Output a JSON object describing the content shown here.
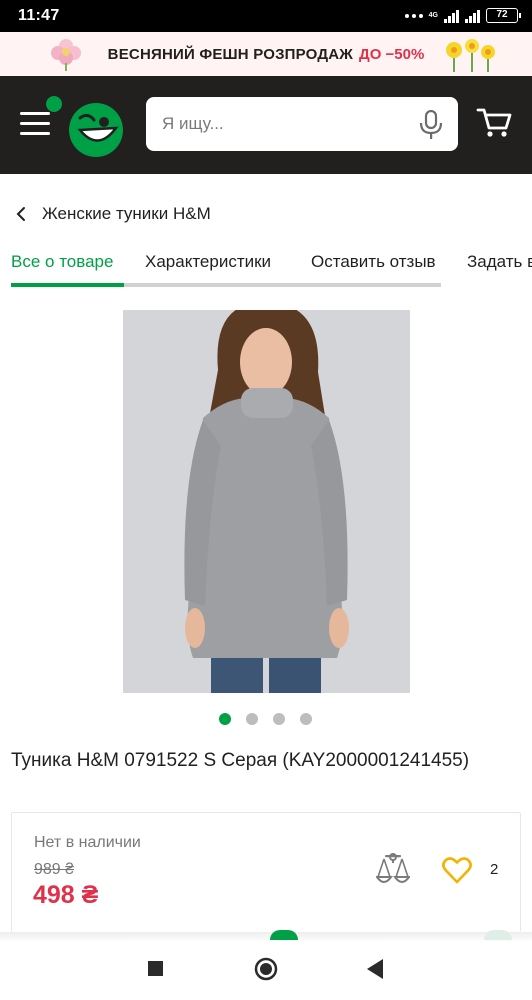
{
  "status_bar": {
    "time": "11:47",
    "network": "4G",
    "battery": "72"
  },
  "promo_banner": {
    "text": "ВЕСНЯНИЙ ФЕШН РОЗПРОДАЖ",
    "discount": "ДО −50%"
  },
  "header": {
    "search_placeholder": "Я ищу...",
    "icons": [
      "menu-icon",
      "logo",
      "mic-icon",
      "cart-icon"
    ]
  },
  "breadcrumb": {
    "label": "Женские туники H&M"
  },
  "tabs": [
    {
      "label": "Все о товаре",
      "active": true
    },
    {
      "label": "Характеристики",
      "active": false
    },
    {
      "label": "Оставить отзыв",
      "active": false
    },
    {
      "label": "Задать вопрос",
      "active": false
    }
  ],
  "gallery": {
    "slides_total": 4,
    "active_slide": 1
  },
  "product": {
    "title": "Туника H&M 0791522 S Серая (KAY2000001241455)",
    "availability": "Нет в наличии",
    "old_price": "989 ₴",
    "price": "498 ₴",
    "wishlist_count": "2"
  },
  "colors": {
    "accent": "#00a046",
    "price_red": "#e0314b",
    "header_bg": "#221f1f",
    "promo_bg": "#fff3f3",
    "heart": "#f5b200"
  }
}
